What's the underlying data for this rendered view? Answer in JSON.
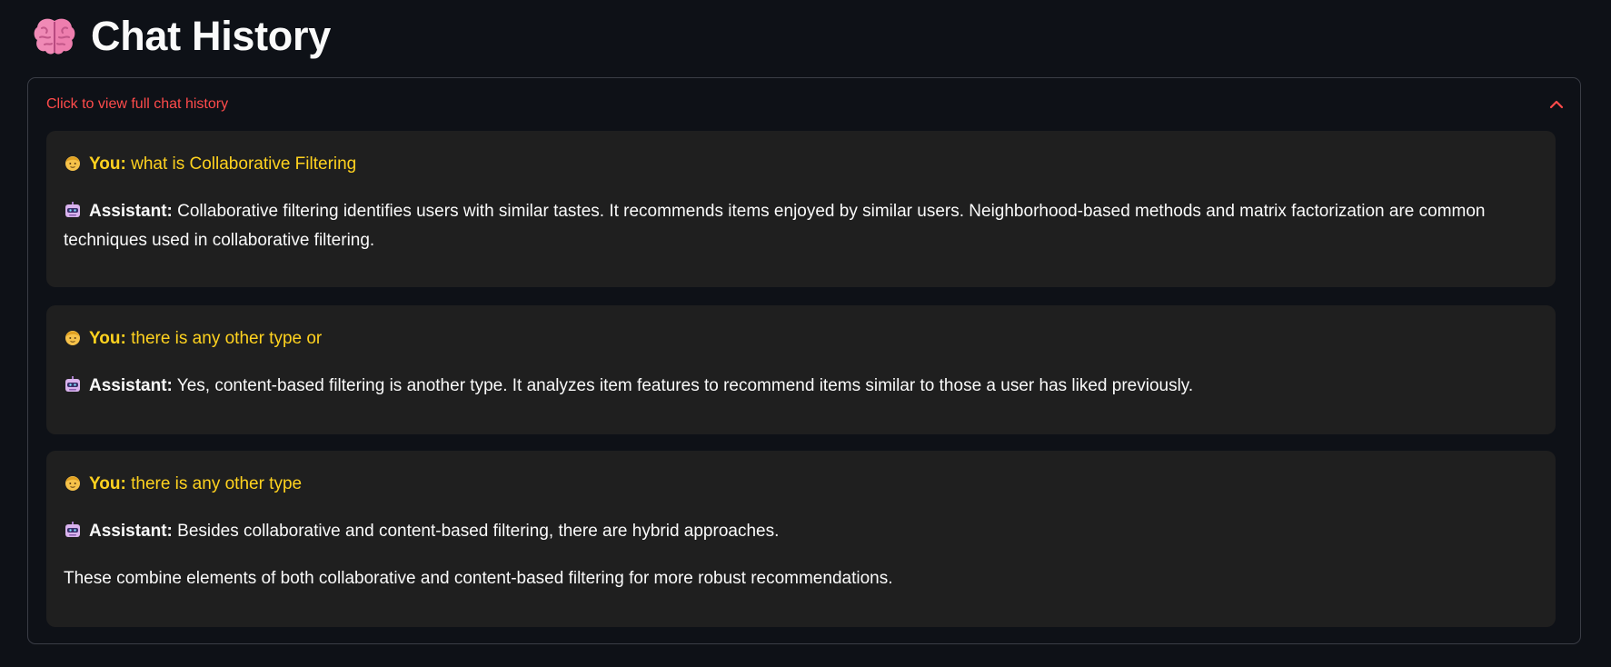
{
  "page": {
    "title": "Chat History",
    "title_icon": "brain-icon"
  },
  "expander": {
    "label": "Click to view full chat history",
    "expanded": true,
    "toggle_icon": "chevron-up-icon"
  },
  "colors": {
    "background": "#0e1117",
    "card": "#1f1f1f",
    "user_text": "#ffd21f",
    "expander_label": "#ff4b4b"
  },
  "chat": [
    {
      "user_icon": "person-icon",
      "user_label": "You:",
      "user_text": "what is Collaborative Filtering",
      "assistant_icon": "robot-icon",
      "assistant_label": "Assistant:",
      "assistant_text": "Collaborative filtering identifies users with similar tastes. It recommends items enjoyed by similar users. Neighborhood-based methods and matrix factorization are common techniques used in collaborative filtering.",
      "assistant_extra": ""
    },
    {
      "user_icon": "person-icon",
      "user_label": "You:",
      "user_text": "there is any other type or",
      "assistant_icon": "robot-icon",
      "assistant_label": "Assistant:",
      "assistant_text": "Yes, content-based filtering is another type. It analyzes item features to recommend items similar to those a user has liked previously.",
      "assistant_extra": ""
    },
    {
      "user_icon": "person-icon",
      "user_label": "You:",
      "user_text": "there is any other type",
      "assistant_icon": "robot-icon",
      "assistant_label": "Assistant:",
      "assistant_text": "Besides collaborative and content-based filtering, there are hybrid approaches.",
      "assistant_extra": "These combine elements of both collaborative and content-based filtering for more robust recommendations."
    }
  ]
}
